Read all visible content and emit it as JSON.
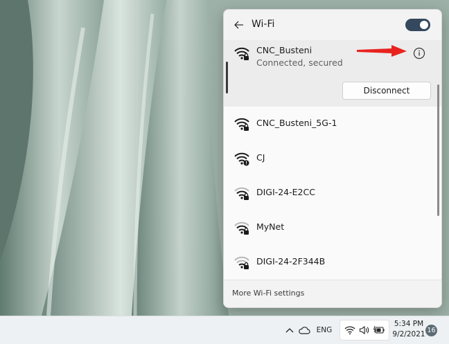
{
  "flyout": {
    "title": "Wi-Fi",
    "wifi_enabled": true,
    "back_icon": "arrow-left-icon"
  },
  "networks": [
    {
      "name": "CNC_Busteni",
      "status": "Connected, secured",
      "connected": true,
      "secured": true,
      "warning": false,
      "strength": 4,
      "action": "Disconnect"
    },
    {
      "name": "CNC_Busteni_5G-1",
      "connected": false,
      "secured": true,
      "warning": false,
      "strength": 4
    },
    {
      "name": "CJ",
      "connected": false,
      "secured": false,
      "warning": true,
      "strength": 4
    },
    {
      "name": "DIGI-24-E2CC",
      "connected": false,
      "secured": true,
      "warning": false,
      "strength": 3
    },
    {
      "name": "MyNet",
      "connected": false,
      "secured": true,
      "warning": false,
      "strength": 3
    },
    {
      "name": "DIGI-24-2F344B",
      "connected": false,
      "secured": true,
      "warning": false,
      "strength": 2
    }
  ],
  "footer": {
    "link": "More Wi-Fi settings"
  },
  "taskbar": {
    "language": "ENG",
    "time": "5:34 PM",
    "date": "9/2/2021",
    "notification_count": "16"
  },
  "colors": {
    "toggle_on": "#34495e",
    "annotation_arrow": "#e8231f",
    "flyout_bg": "#f3f3f3",
    "connected_row_bg": "#ececec"
  }
}
